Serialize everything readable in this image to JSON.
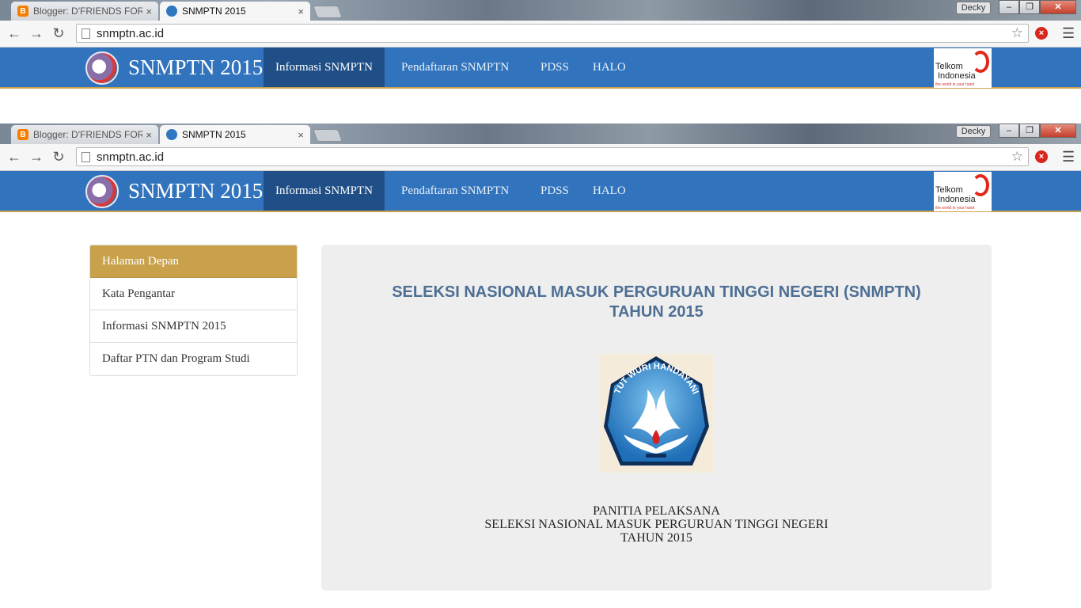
{
  "browser": {
    "tabs": [
      {
        "label": "Blogger: D'FRIENDS FORE",
        "icon": "blogger-icon",
        "active": false
      },
      {
        "label": "SNMPTN 2015",
        "icon": "tutwuri-icon",
        "active": true
      }
    ],
    "close_glyph": "×",
    "user_button": "Decky",
    "url": "snmptn.ac.id"
  },
  "site": {
    "brand": "SNMPTN 2015",
    "nav": [
      {
        "label": "Informasi SNMPTN",
        "active": true
      },
      {
        "label": "Pendaftaran SNMPTN",
        "active": false
      },
      {
        "label": "PDSS",
        "active": false
      },
      {
        "label": "HALO",
        "active": false
      }
    ],
    "sponsor": {
      "line1": "Telkom",
      "line2": "Indonesia",
      "tagline": "the world in your hand"
    }
  },
  "sidebar": {
    "items": [
      {
        "label": "Halaman Depan",
        "active": true
      },
      {
        "label": "Kata Pengantar",
        "active": false
      },
      {
        "label": "Informasi SNMPTN 2015",
        "active": false
      },
      {
        "label": "Daftar PTN dan Program Studi",
        "active": false
      }
    ]
  },
  "main": {
    "title_line1": "SELEKSI NASIONAL MASUK PERGURUAN TINGGI NEGERI (SNMPTN)",
    "title_line2": "TAHUN 2015",
    "emblem_text": "TUT WURI HANDAYANI",
    "footer_line1": "PANITIA PELAKSANA",
    "footer_line2": "SELEKSI NASIONAL MASUK PERGURUAN TINGGI NEGERI",
    "footer_line3": "TAHUN 2015"
  },
  "colors": {
    "navbar": "#3174bd",
    "nav_active": "#1f4f86",
    "accent_gold": "#c9a14a",
    "title_blue": "#4e6f94"
  }
}
